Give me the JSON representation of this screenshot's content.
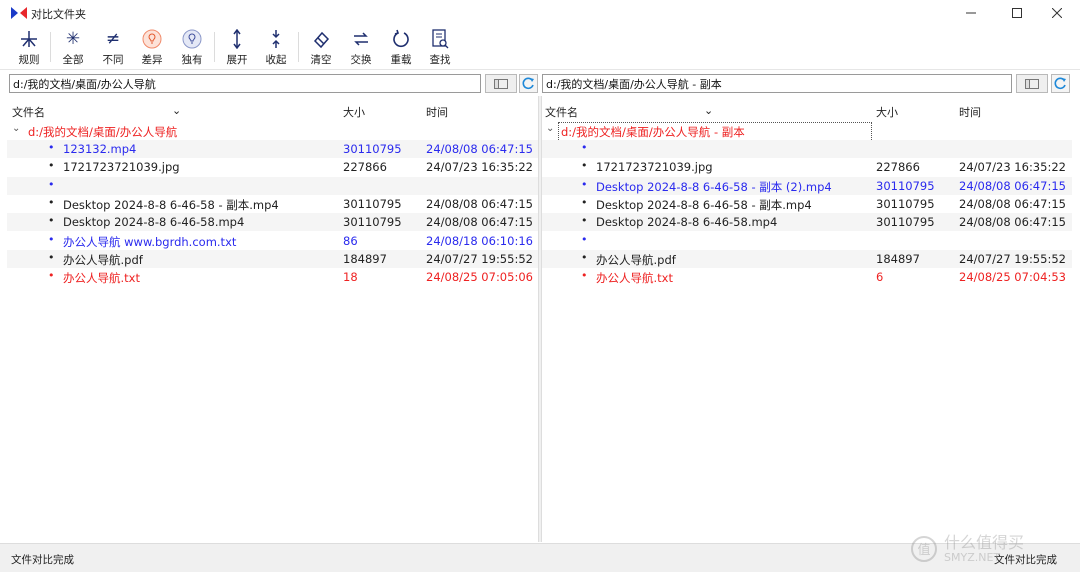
{
  "window": {
    "title": "对比文件夹",
    "controls": {
      "minimize": "minimize-icon",
      "maximize": "maximize-icon",
      "close": "close-icon"
    }
  },
  "toolbar": {
    "buttons": [
      {
        "label": "规则",
        "icon": "rules-icon"
      },
      {
        "label": "全部",
        "icon": "all-icon"
      },
      {
        "label": "不同",
        "icon": "not-equal-icon"
      },
      {
        "label": "差异",
        "icon": "bulb-diff-icon"
      },
      {
        "label": "独有",
        "icon": "bulb-unique-icon"
      },
      {
        "label": "展开",
        "icon": "expand-icon"
      },
      {
        "label": "收起",
        "icon": "collapse-icon"
      },
      {
        "label": "清空",
        "icon": "eraser-icon"
      },
      {
        "label": "交换",
        "icon": "swap-icon"
      },
      {
        "label": "重载",
        "icon": "reload-icon"
      },
      {
        "label": "查找",
        "icon": "find-icon"
      }
    ]
  },
  "left": {
    "path": "d:/我的文档/桌面/办公人导航",
    "headers": {
      "name": "文件名",
      "size": "大小",
      "time": "时间"
    },
    "root": "d:/我的文档/桌面/办公人导航",
    "rows": [
      {
        "name": "123132.mp4",
        "size": "30110795",
        "time": "24/08/08 06:47:15",
        "color": "blue"
      },
      {
        "name": "1721723721039.jpg",
        "size": "227866",
        "time": "24/07/23 16:35:22",
        "color": "black"
      },
      {
        "name": "",
        "size": "",
        "time": "",
        "color": "blue"
      },
      {
        "name": "Desktop 2024-8-8 6-46-58 - 副本.mp4",
        "size": "30110795",
        "time": "24/08/08 06:47:15",
        "color": "black"
      },
      {
        "name": "Desktop 2024-8-8 6-46-58.mp4",
        "size": "30110795",
        "time": "24/08/08 06:47:15",
        "color": "black"
      },
      {
        "name": "办公人导航 www.bgrdh.com.txt",
        "size": "86",
        "time": "24/08/18 06:10:16",
        "color": "blue"
      },
      {
        "name": "办公人导航.pdf",
        "size": "184897",
        "time": "24/07/27 19:55:52",
        "color": "black"
      },
      {
        "name": "办公人导航.txt",
        "size": "18",
        "time": "24/08/25 07:05:06",
        "color": "red"
      }
    ]
  },
  "right": {
    "path": "d:/我的文档/桌面/办公人导航 - 副本",
    "headers": {
      "name": "文件名",
      "size": "大小",
      "time": "时间"
    },
    "root": "d:/我的文档/桌面/办公人导航 - 副本",
    "rows": [
      {
        "name": "",
        "size": "",
        "time": "",
        "color": "blue"
      },
      {
        "name": "1721723721039.jpg",
        "size": "227866",
        "time": "24/07/23 16:35:22",
        "color": "black"
      },
      {
        "name": "Desktop 2024-8-8 6-46-58 - 副本 (2).mp4",
        "size": "30110795",
        "time": "24/08/08 06:47:15",
        "color": "blue"
      },
      {
        "name": "Desktop 2024-8-8 6-46-58 - 副本.mp4",
        "size": "30110795",
        "time": "24/08/08 06:47:15",
        "color": "black"
      },
      {
        "name": "Desktop 2024-8-8 6-46-58.mp4",
        "size": "30110795",
        "time": "24/08/08 06:47:15",
        "color": "black"
      },
      {
        "name": "",
        "size": "",
        "time": "",
        "color": "blue"
      },
      {
        "name": "办公人导航.pdf",
        "size": "184897",
        "time": "24/07/27 19:55:52",
        "color": "black"
      },
      {
        "name": "办公人导航.txt",
        "size": "6",
        "time": "24/08/25 07:04:53",
        "color": "red"
      }
    ]
  },
  "status": {
    "left": "文件对比完成",
    "right": "文件对比完成"
  },
  "watermark": {
    "text": "什么值得买",
    "sub": "SMYZ.NET"
  },
  "colors": {
    "blue": "#2a2aee",
    "red": "#ee2222",
    "black": "#222222",
    "accent": "#1f2f6f"
  }
}
